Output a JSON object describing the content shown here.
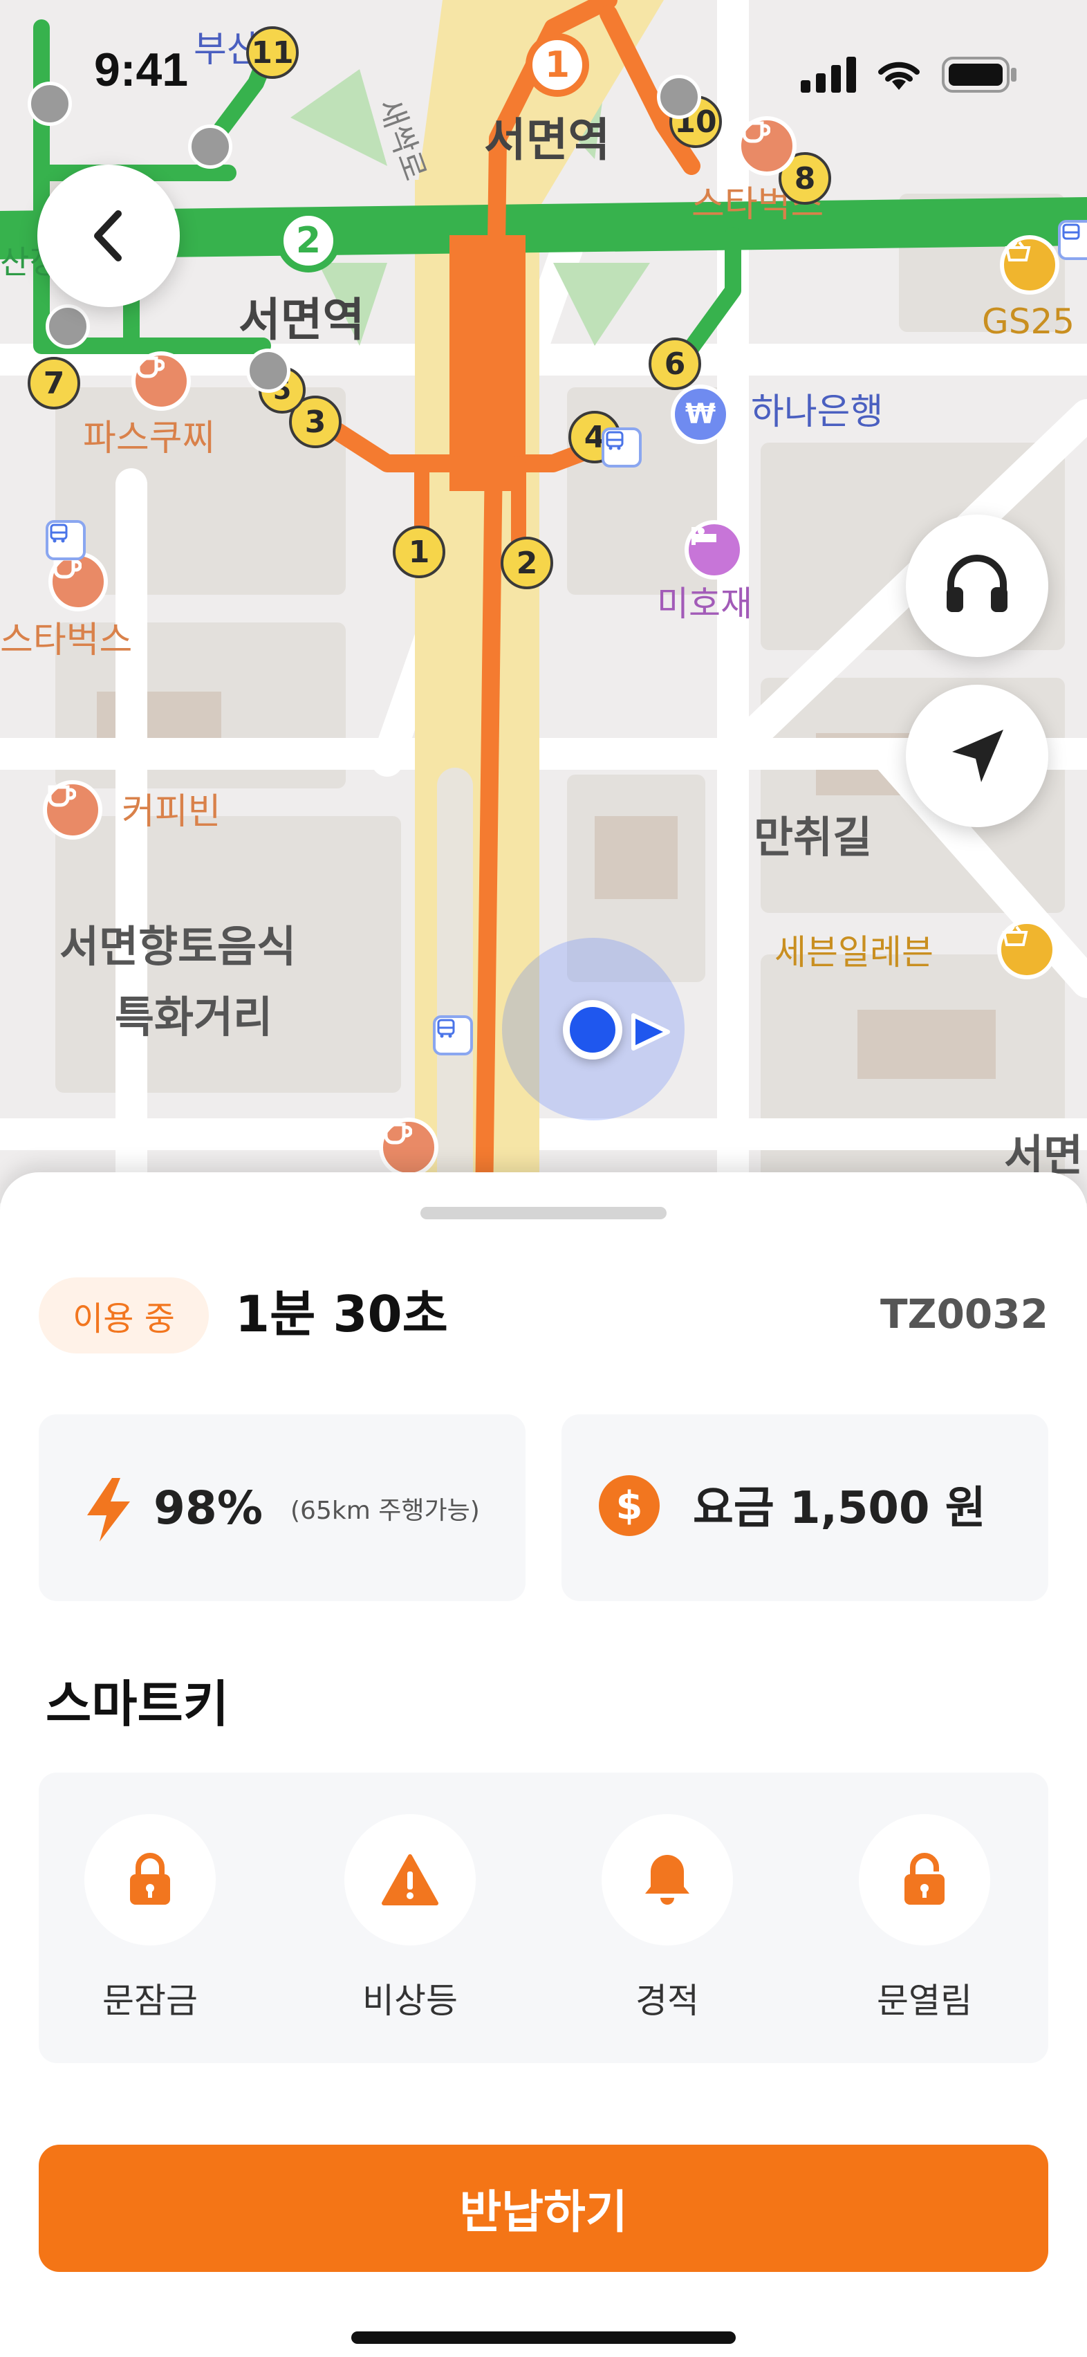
{
  "status_bar": {
    "time": "9:41"
  },
  "map": {
    "labels": {
      "station_top": "서면역",
      "station_left": "서면역",
      "road": "새싹로",
      "starbucks_top": "스타벅스",
      "starbucks_left": "스타벅스",
      "paskucci": "파스쿠찌",
      "hana_bank": "하나은행",
      "mihojae": "미호재",
      "coffeebean": "커피빈",
      "manchwigil": "만취길",
      "seven_eleven": "세븐일레븐",
      "food_street_line1": "서면향토음식",
      "food_street_line2": "특화거리",
      "gs25": "GS25",
      "busan_partial": "부산은",
      "sanjeong_partial": "산정",
      "seomyeon_partial": "서면"
    },
    "line_badges": {
      "line1": "1",
      "line2": "2"
    },
    "exit_numbers": [
      "1",
      "2",
      "3",
      "4",
      "5",
      "6",
      "7",
      "8",
      "10",
      "11"
    ]
  },
  "buttons": {
    "back_icon": "chevron-left-icon",
    "support_icon": "headset-icon",
    "locate_icon": "navigation-arrow-icon"
  },
  "ride": {
    "status": "이용 중",
    "elapsed": "1분 30초",
    "vehicle_id": "TZ0032",
    "battery_percent": "98%",
    "battery_range": "(65km 주행가능)",
    "fare_symbol": "$",
    "fare": "요금 1,500 원"
  },
  "smartkey": {
    "title": "스마트키",
    "items": [
      {
        "label": "문잠금",
        "icon": "lock-icon"
      },
      {
        "label": "비상등",
        "icon": "warning-icon"
      },
      {
        "label": "경적",
        "icon": "bell-icon"
      },
      {
        "label": "문열림",
        "icon": "unlock-icon"
      }
    ]
  },
  "return_button": "반납하기",
  "colors": {
    "accent": "#f47516",
    "line1": "#f47b30",
    "line2": "#37b24d",
    "user_dot": "#1f57ee"
  }
}
